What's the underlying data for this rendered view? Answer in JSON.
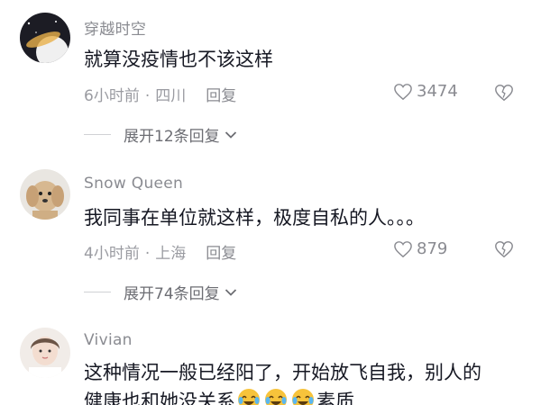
{
  "comments": [
    {
      "username": "穿越时空",
      "text": "就算没疫情也不该这样",
      "time": "6小时前",
      "location": "四川",
      "reply_label": "回复",
      "likes": "3474",
      "expand_label": "展开12条回复"
    },
    {
      "username": "Snow Queen",
      "text": "我同事在单位就这样，极度自私的人。。。",
      "time": "4小时前",
      "location": "上海",
      "reply_label": "回复",
      "likes": "879",
      "expand_label": "展开74条回复"
    },
    {
      "username": "Vivian",
      "text_line1": "这种情况一般已经阳了，开始放飞自我，别人的",
      "text_line2_pre": "健康也和她没关系",
      "text_line2_post": "素质"
    }
  ],
  "icons": {
    "like": "heart-outline-icon",
    "dislike": "broken-heart-icon",
    "expand": "chevron-down-icon",
    "emoji": "crying-laughing-emoji"
  },
  "colors": {
    "username": "#8a8b91",
    "text": "#161823",
    "meta": "#9a9ba1"
  }
}
